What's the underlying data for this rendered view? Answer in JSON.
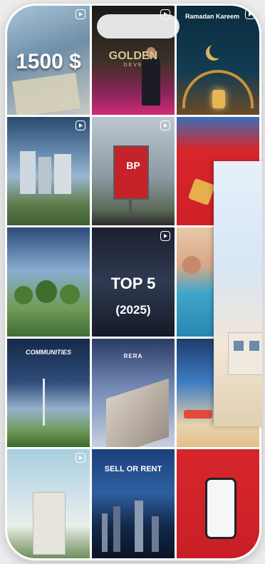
{
  "tiles": [
    {
      "id": "money-1500",
      "headline": "1500 $",
      "reel": true
    },
    {
      "id": "golden-event",
      "headline": "GOLDEN",
      "sub": "DEVE",
      "reel": true
    },
    {
      "id": "ramadan",
      "headline": "Ramadan Kareem",
      "reel": true
    },
    {
      "id": "towers-park",
      "reel": true
    },
    {
      "id": "billboard",
      "sign": "BP",
      "reel": true
    },
    {
      "id": "red-promo",
      "reel": false
    },
    {
      "id": "villa-community",
      "reel": false
    },
    {
      "id": "top5",
      "headline": "TOP 5",
      "year": "(2025)",
      "reel": true
    },
    {
      "id": "pool-woman",
      "reel": false
    },
    {
      "id": "communities",
      "headline": "COMMUNITIES",
      "reel": false
    },
    {
      "id": "rera-tower",
      "headline": "RERA",
      "reel": false
    },
    {
      "id": "beach-investment",
      "reel": false
    },
    {
      "id": "white-building",
      "reel": true
    },
    {
      "id": "sell-or-rent",
      "headline": "SELL OR RENT",
      "reel": false
    },
    {
      "id": "phone-app",
      "reel": false
    }
  ],
  "colors": {
    "red": "#d7262c",
    "navy": "#1b3a63",
    "gold": "#d2a24c"
  }
}
